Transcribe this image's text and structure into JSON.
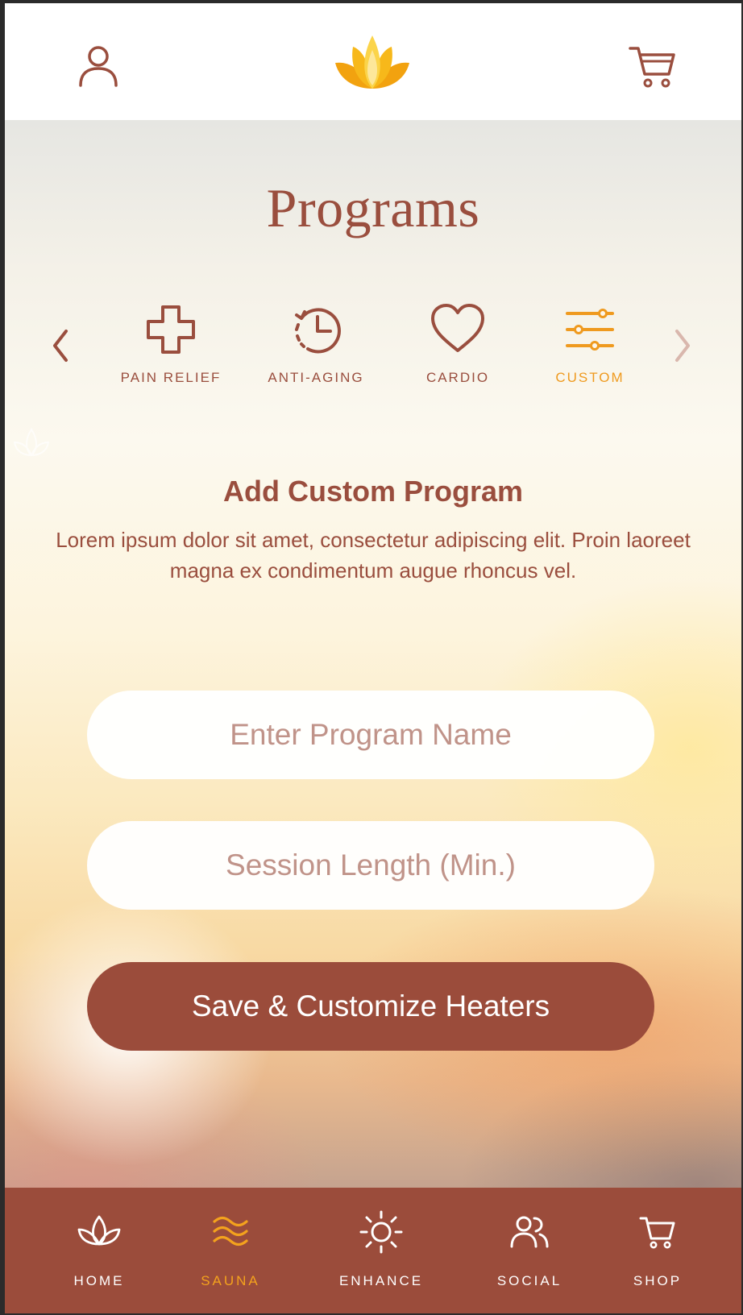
{
  "header": {
    "profile_icon": "user-icon",
    "logo_icon": "lotus-logo",
    "cart_icon": "cart-icon"
  },
  "main": {
    "title": "Programs",
    "categories": [
      {
        "label": "PAIN RELIEF",
        "icon": "cross-icon",
        "active": false
      },
      {
        "label": "ANTI-AGING",
        "icon": "history-clock-icon",
        "active": false
      },
      {
        "label": "CARDIO",
        "icon": "heart-icon",
        "active": false
      },
      {
        "label": "CUSTOM",
        "icon": "sliders-icon",
        "active": true
      }
    ],
    "section_title": "Add Custom Program",
    "description": "Lorem ipsum dolor sit amet, consectetur adipiscing elit. Proin laoreet magna ex condimentum augue rhoncus vel.",
    "program_name": {
      "value": "",
      "placeholder": "Enter Program Name"
    },
    "session_length": {
      "value": "",
      "placeholder": "Session Length (Min.)"
    },
    "save_label": "Save & Customize Heaters"
  },
  "nav": {
    "items": [
      {
        "label": "HOME",
        "icon": "lotus-icon",
        "active": false
      },
      {
        "label": "SAUNA",
        "icon": "waves-icon",
        "active": true
      },
      {
        "label": "ENHANCE",
        "icon": "sun-icon",
        "active": false
      },
      {
        "label": "SOCIAL",
        "icon": "users-icon",
        "active": false
      },
      {
        "label": "SHOP",
        "icon": "cart-icon",
        "active": false
      }
    ]
  },
  "colors": {
    "brand_brown": "#9b4c3b",
    "accent_orange": "#ef9a1f",
    "text_brown": "#9a4e3e"
  }
}
